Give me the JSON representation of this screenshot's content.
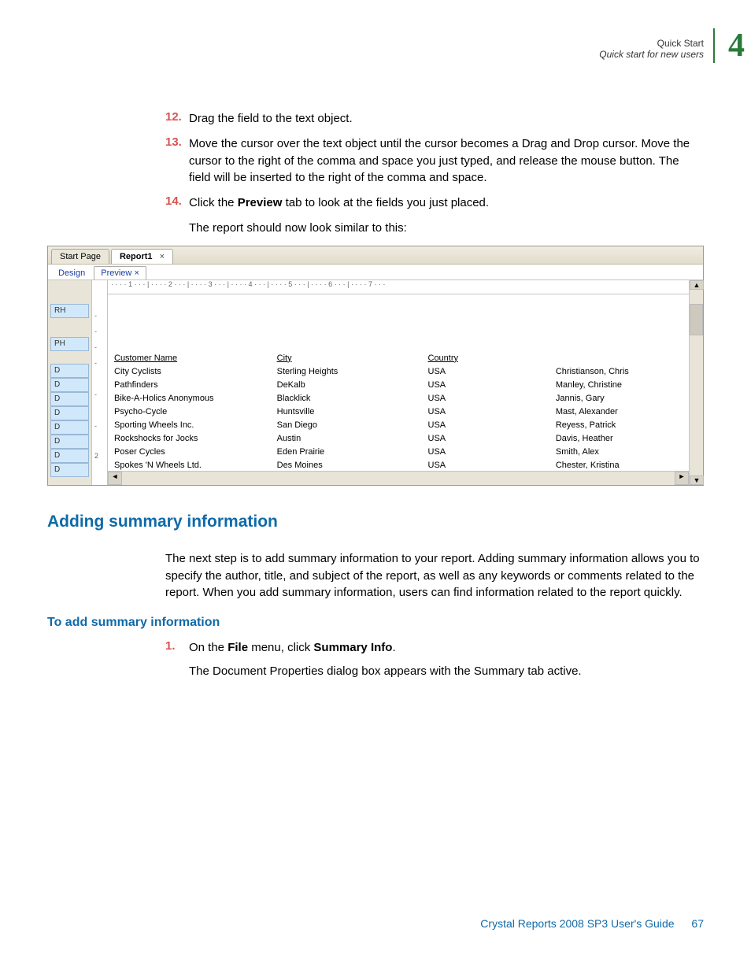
{
  "header": {
    "breadcrumb_line1": "Quick Start",
    "breadcrumb_line2": "Quick start for new users",
    "chapter_number": "4"
  },
  "steps_block1": [
    {
      "num": "12.",
      "text_before": "Drag the field to the text object.",
      "bold": "",
      "text_after": ""
    },
    {
      "num": "13.",
      "text_before": "Move the cursor over the text object until the cursor becomes a Drag and Drop cursor. Move the cursor to the right of the comma and space you just typed, and release the mouse button. The field will be inserted to the right of the comma and space.",
      "bold": "",
      "text_after": ""
    },
    {
      "num": "14.",
      "text_before": "Click the ",
      "bold": "Preview",
      "text_after": " tab to look at the fields you just placed."
    }
  ],
  "result_line": "The report should now look similar to this:",
  "screenshot": {
    "doc_tabs": {
      "start": "Start Page",
      "report": "Report1",
      "close_glyph": "×"
    },
    "sub_tabs": {
      "design": "Design",
      "preview": "Preview",
      "close_glyph": "×"
    },
    "hruler_text": "· · · · 1 · · · | · · · · 2 · · · | · · · · 3 · · · | · · · · 4 · · · | · · · · 5 · · · | · · · · 6 · · · | · · · · 7 · · ·",
    "sections": {
      "rh": "RH",
      "ph": "PH",
      "d": "D"
    },
    "vruler_marks": [
      "-",
      "-",
      "-",
      "-",
      "-",
      "-",
      "2",
      "-"
    ],
    "columns": [
      "Customer Name",
      "City",
      "Country",
      ""
    ],
    "rows": [
      [
        "City Cyclists",
        "Sterling Heights",
        "USA",
        "Christianson, Chris"
      ],
      [
        "Pathfinders",
        "DeKalb",
        "USA",
        "Manley, Christine"
      ],
      [
        "Bike-A-Holics Anonymous",
        "Blacklick",
        "USA",
        "Jannis, Gary"
      ],
      [
        "Psycho-Cycle",
        "Huntsville",
        "USA",
        "Mast, Alexander"
      ],
      [
        "Sporting Wheels Inc.",
        "San Diego",
        "USA",
        "Reyess, Patrick"
      ],
      [
        "Rockshocks for Jocks",
        "Austin",
        "USA",
        "Davis, Heather"
      ],
      [
        "Poser Cycles",
        "Eden Prairie",
        "USA",
        "Smith, Alex"
      ],
      [
        "Spokes 'N Wheels Ltd.",
        "Des Moines",
        "USA",
        "Chester, Kristina"
      ]
    ],
    "scroll": {
      "left": "◄",
      "right": "►",
      "up": "▲",
      "down": "▼"
    }
  },
  "section_heading": "Adding summary information",
  "section_para": "The next step is to add summary information to your report. Adding summary information allows you to specify the author, title, and subject of the report, as well as any keywords or comments related to the report. When you add summary information, users can find information related to the report quickly.",
  "sub_heading": "To add summary information",
  "steps_block2": [
    {
      "num": "1.",
      "text_before": "On the ",
      "bold1": "File",
      "text_mid": " menu, click ",
      "bold2": "Summary Info",
      "text_after": "."
    }
  ],
  "sub_result": "The Document Properties dialog box appears with the Summary tab active.",
  "footer": {
    "title": "Crystal Reports 2008 SP3 User's Guide",
    "page": "67"
  }
}
